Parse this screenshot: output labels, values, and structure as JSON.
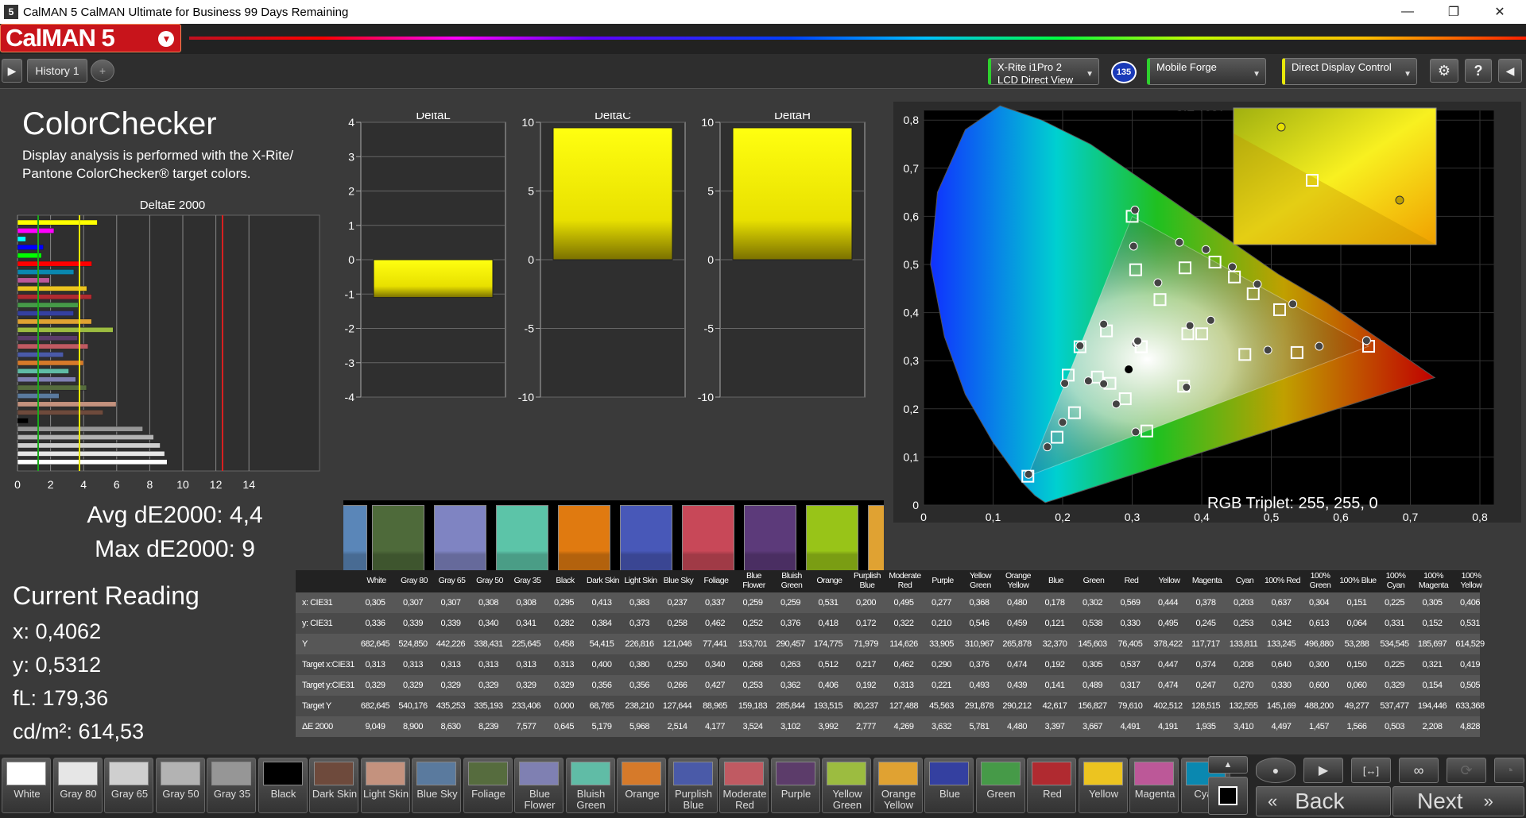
{
  "window": {
    "title": "CalMAN 5 CalMAN Ultimate for Business 99 Days Remaining",
    "minimize": "—",
    "restore": "❐",
    "close": "✕"
  },
  "brand": {
    "name": "CalMAN 5",
    "drop_icon": "chevron-down-icon"
  },
  "toolbar": {
    "history_tab": "History 1",
    "add_tab": "+",
    "meter": {
      "line1": "X-Rite i1Pro 2",
      "line2": "LCD Direct View"
    },
    "badge": "135",
    "source": "Mobile Forge",
    "display": "Direct Display Control"
  },
  "colorchecker": {
    "title": "ColorChecker",
    "description": "Display analysis is performed with the X-Rite/ Pantone ColorChecker® target colors."
  },
  "de_chart": {
    "title": "DeltaE 2000",
    "ticks": [
      "0",
      "2",
      "4",
      "6",
      "8",
      "10",
      "12",
      "14"
    ]
  },
  "summary": {
    "avg": "Avg dE2000: 4,4",
    "max": "Max dE2000: 9"
  },
  "current_reading": {
    "title": "Current Reading",
    "x": "x: 0,4062",
    "y": "y: 0,5312",
    "fl": "fL: 179,36",
    "cdm2": "cd/m²: 614,53"
  },
  "delta_charts": [
    {
      "title": "DeltaL",
      "ticks": [
        "4",
        "3",
        "2",
        "1",
        "0",
        "-1",
        "-2",
        "-3",
        "-4"
      ],
      "ylim": [
        -4,
        4
      ],
      "value": -1.1
    },
    {
      "title": "DeltaC",
      "ticks": [
        "10",
        "5",
        "0",
        "-5",
        "-10"
      ],
      "ylim": [
        -10,
        10
      ],
      "value": 9.6
    },
    {
      "title": "DeltaH",
      "ticks": [
        "10",
        "5",
        "0",
        "-5",
        "-10"
      ],
      "ylim": [
        -10,
        10
      ],
      "value": 9.6
    }
  ],
  "swatches": [
    {
      "label": "Sky",
      "color": "#5a86b8"
    },
    {
      "label": "Foliage",
      "color": "#4e6a3a"
    },
    {
      "label": "Blue Flower",
      "color": "#7f84c2"
    },
    {
      "label": "Bluish Green",
      "color": "#5cc4a8"
    },
    {
      "label": "Orange",
      "color": "#e07a10"
    },
    {
      "label": "Purplish Blue",
      "color": "#4858b8"
    },
    {
      "label": "Moderate Red",
      "color": "#c84858"
    },
    {
      "label": "Purple",
      "color": "#5c3a7a"
    },
    {
      "label": "Yellow Green",
      "color": "#98c418"
    }
  ],
  "cie": {
    "title": "CIE 1931 xy",
    "xticks": [
      "0",
      "0,1",
      "0,2",
      "0,3",
      "0,4",
      "0,5",
      "0,6",
      "0,7",
      "0,8"
    ],
    "yticks": [
      "0",
      "0,1",
      "0,2",
      "0,3",
      "0,4",
      "0,5",
      "0,6",
      "0,7",
      "0,8"
    ],
    "rgb_triplet": "RGB Triplet: 255, 255, 0"
  },
  "table": {
    "columns": [
      "White",
      "Gray 80",
      "Gray 65",
      "Gray 50",
      "Gray 35",
      "Black",
      "Dark Skin",
      "Light Skin",
      "Blue Sky",
      "Foliage",
      "Blue Flower",
      "Bluish Green",
      "Orange",
      "Purplish Blue",
      "Moderate Red",
      "Purple",
      "Yellow Green",
      "Orange Yellow",
      "Blue",
      "Green",
      "Red",
      "Yellow",
      "Magenta",
      "Cyan",
      "100% Red",
      "100% Green",
      "100% Blue",
      "100% Cyan",
      "100% Magenta",
      "100% Yellow"
    ],
    "rows": [
      {
        "label": "x: CIE31",
        "values": [
          "0,305",
          "0,307",
          "0,307",
          "0,308",
          "0,308",
          "0,295",
          "0,413",
          "0,383",
          "0,237",
          "0,337",
          "0,259",
          "0,259",
          "0,531",
          "0,200",
          "0,495",
          "0,277",
          "0,368",
          "0,480",
          "0,178",
          "0,302",
          "0,569",
          "0,444",
          "0,378",
          "0,203",
          "0,637",
          "0,304",
          "0,151",
          "0,225",
          "0,305",
          "0,406"
        ]
      },
      {
        "label": "y: CIE31",
        "values": [
          "0,336",
          "0,339",
          "0,339",
          "0,340",
          "0,341",
          "0,282",
          "0,384",
          "0,373",
          "0,258",
          "0,462",
          "0,252",
          "0,376",
          "0,418",
          "0,172",
          "0,322",
          "0,210",
          "0,546",
          "0,459",
          "0,121",
          "0,538",
          "0,330",
          "0,495",
          "0,245",
          "0,253",
          "0,342",
          "0,613",
          "0,064",
          "0,331",
          "0,152",
          "0,531"
        ]
      },
      {
        "label": "Y",
        "values": [
          "682,645",
          "524,850",
          "442,226",
          "338,431",
          "225,645",
          "0,458",
          "54,415",
          "226,816",
          "121,046",
          "77,441",
          "153,701",
          "290,457",
          "174,775",
          "71,979",
          "114,626",
          "33,905",
          "310,967",
          "265,878",
          "32,370",
          "145,603",
          "76,405",
          "378,422",
          "117,717",
          "133,811",
          "133,245",
          "496,880",
          "53,288",
          "534,545",
          "185,697",
          "614,529"
        ]
      },
      {
        "label": "Target x:CIE31",
        "values": [
          "0,313",
          "0,313",
          "0,313",
          "0,313",
          "0,313",
          "0,313",
          "0,400",
          "0,380",
          "0,250",
          "0,340",
          "0,268",
          "0,263",
          "0,512",
          "0,217",
          "0,462",
          "0,290",
          "0,376",
          "0,474",
          "0,192",
          "0,305",
          "0,537",
          "0,447",
          "0,374",
          "0,208",
          "0,640",
          "0,300",
          "0,150",
          "0,225",
          "0,321",
          "0,419"
        ]
      },
      {
        "label": "Target y:CIE31",
        "values": [
          "0,329",
          "0,329",
          "0,329",
          "0,329",
          "0,329",
          "0,329",
          "0,356",
          "0,356",
          "0,266",
          "0,427",
          "0,253",
          "0,362",
          "0,406",
          "0,192",
          "0,313",
          "0,221",
          "0,493",
          "0,439",
          "0,141",
          "0,489",
          "0,317",
          "0,474",
          "0,247",
          "0,270",
          "0,330",
          "0,600",
          "0,060",
          "0,329",
          "0,154",
          "0,505"
        ]
      },
      {
        "label": "Target Y",
        "values": [
          "682,645",
          "540,176",
          "435,253",
          "335,193",
          "233,406",
          "0,000",
          "68,765",
          "238,210",
          "127,644",
          "88,965",
          "159,183",
          "285,844",
          "193,515",
          "80,237",
          "127,488",
          "45,563",
          "291,878",
          "290,212",
          "42,617",
          "156,827",
          "79,610",
          "402,512",
          "128,515",
          "132,555",
          "145,169",
          "488,200",
          "49,277",
          "537,477",
          "194,446",
          "633,368"
        ]
      },
      {
        "label": "ΔE 2000",
        "values": [
          "9,049",
          "8,900",
          "8,630",
          "8,239",
          "7,577",
          "0,645",
          "5,179",
          "5,968",
          "2,514",
          "4,177",
          "3,524",
          "3,102",
          "3,992",
          "2,777",
          "4,269",
          "3,632",
          "5,781",
          "4,480",
          "3,397",
          "3,667",
          "4,491",
          "4,191",
          "1,935",
          "3,410",
          "4,497",
          "1,457",
          "1,566",
          "0,503",
          "2,208",
          "4,828"
        ]
      }
    ]
  },
  "bottom_swatches": [
    {
      "label": "White",
      "color": "#ffffff"
    },
    {
      "label": "Gray 80",
      "color": "#e6e6e6"
    },
    {
      "label": "Gray 65",
      "color": "#cfcfcf"
    },
    {
      "label": "Gray 50",
      "color": "#b3b3b3"
    },
    {
      "label": "Gray 35",
      "color": "#969696"
    },
    {
      "label": "Black",
      "color": "#000000"
    },
    {
      "label": "Dark Skin",
      "color": "#6e4a3c"
    },
    {
      "label": "Light Skin",
      "color": "#c4927e"
    },
    {
      "label": "Blue Sky",
      "color": "#5a7a9e"
    },
    {
      "label": "Foliage",
      "color": "#566c3e"
    },
    {
      "label": "Blue Flower",
      "color": "#7f80b2"
    },
    {
      "label": "Bluish Green",
      "color": "#60bca6"
    },
    {
      "label": "Orange",
      "color": "#d67a2a"
    },
    {
      "label": "Purplish Blue",
      "color": "#4a5aa8"
    },
    {
      "label": "Moderate Red",
      "color": "#c05a62"
    },
    {
      "label": "Purple",
      "color": "#5c3c6a"
    },
    {
      "label": "Yellow Green",
      "color": "#9cbc40"
    },
    {
      "label": "Orange Yellow",
      "color": "#e0a232"
    },
    {
      "label": "Blue",
      "color": "#3440a0"
    },
    {
      "label": "Green",
      "color": "#469a48"
    },
    {
      "label": "Red",
      "color": "#b02a30"
    },
    {
      "label": "Yellow",
      "color": "#ecc420"
    },
    {
      "label": "Magenta",
      "color": "#bc5898"
    },
    {
      "label": "Cyan",
      "color": "#0a88b0"
    }
  ],
  "nav": {
    "back": "Back",
    "next": "Next"
  }
}
